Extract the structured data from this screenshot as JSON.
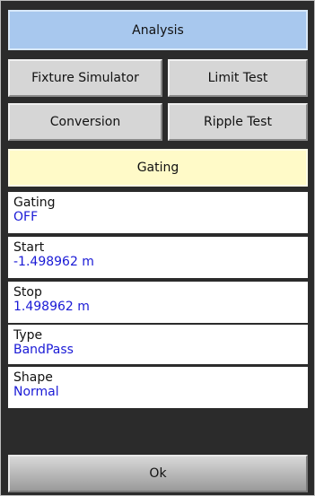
{
  "header": {
    "title": "Analysis"
  },
  "buttons": {
    "fixture_simulator": "Fixture Simulator",
    "limit_test": "Limit Test",
    "conversion": "Conversion",
    "ripple_test": "Ripple Test"
  },
  "section": {
    "title": "Gating"
  },
  "fields": {
    "gating": {
      "label": "Gating",
      "value": "OFF"
    },
    "start": {
      "label": "Start",
      "value": "-1.498962 m"
    },
    "stop": {
      "label": "Stop",
      "value": "1.498962 m"
    },
    "type": {
      "label": "Type",
      "value": "BandPass"
    },
    "shape": {
      "label": "Shape",
      "value": "Normal"
    }
  },
  "footer": {
    "ok_label": "Ok"
  },
  "colors": {
    "header_bg": "#a8c8ee",
    "section_bg": "#fffac8",
    "value_text": "#1a1ad6",
    "panel_bg": "#2b2b2b"
  }
}
